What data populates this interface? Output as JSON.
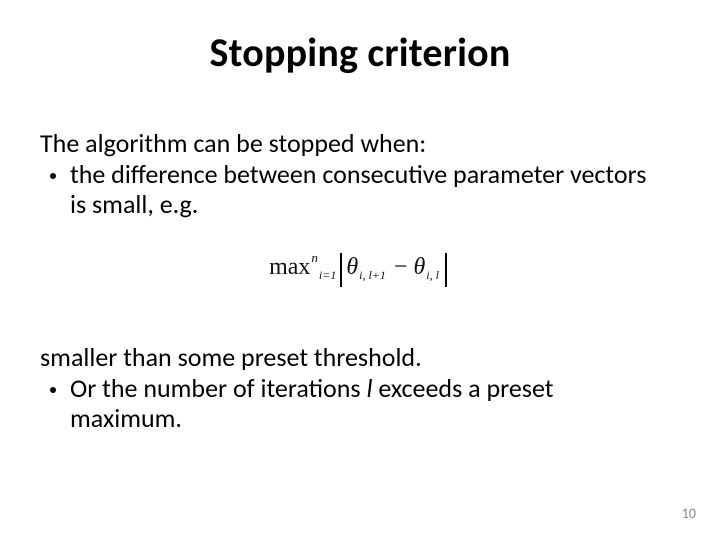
{
  "title": "Stopping criterion",
  "body": {
    "intro": "The algorithm can be stopped when:",
    "bullet1": "the difference between consecutive parameter vectors is small, e.g.",
    "after_intro": "smaller than some preset threshold.",
    "bullet2_pre": "Or the number of iterations ",
    "bullet2_var": "l",
    "bullet2_post": " exceeds a preset maximum."
  },
  "formula": {
    "op": "max",
    "sup": "n",
    "sub": "i=1",
    "theta": "θ",
    "tsub1": "i, l+1",
    "minus": "−",
    "tsub2": "i, l"
  },
  "page_number": "10"
}
